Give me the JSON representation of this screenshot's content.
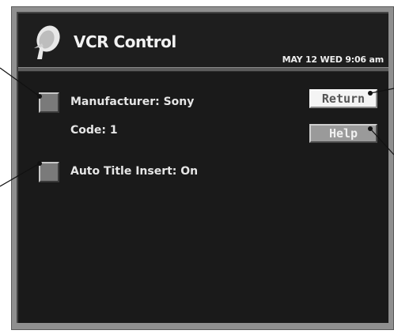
{
  "header": {
    "title": "VCR Control",
    "datetime": "MAY 12 WED  9:06 am",
    "logo_icon": "satellite-dish-icon"
  },
  "settings": [
    {
      "label": "Manufacturer:",
      "value": "Sony"
    },
    {
      "label": "Code:",
      "value": "1"
    },
    {
      "label": "Auto Title Insert:",
      "value": "On"
    }
  ],
  "buttons": {
    "return_label": "Return",
    "help_label": "Help"
  },
  "colors": {
    "screen_bg": "#1a1a1a",
    "frame": "#8f8f8f",
    "text": "#e6e6e6"
  }
}
